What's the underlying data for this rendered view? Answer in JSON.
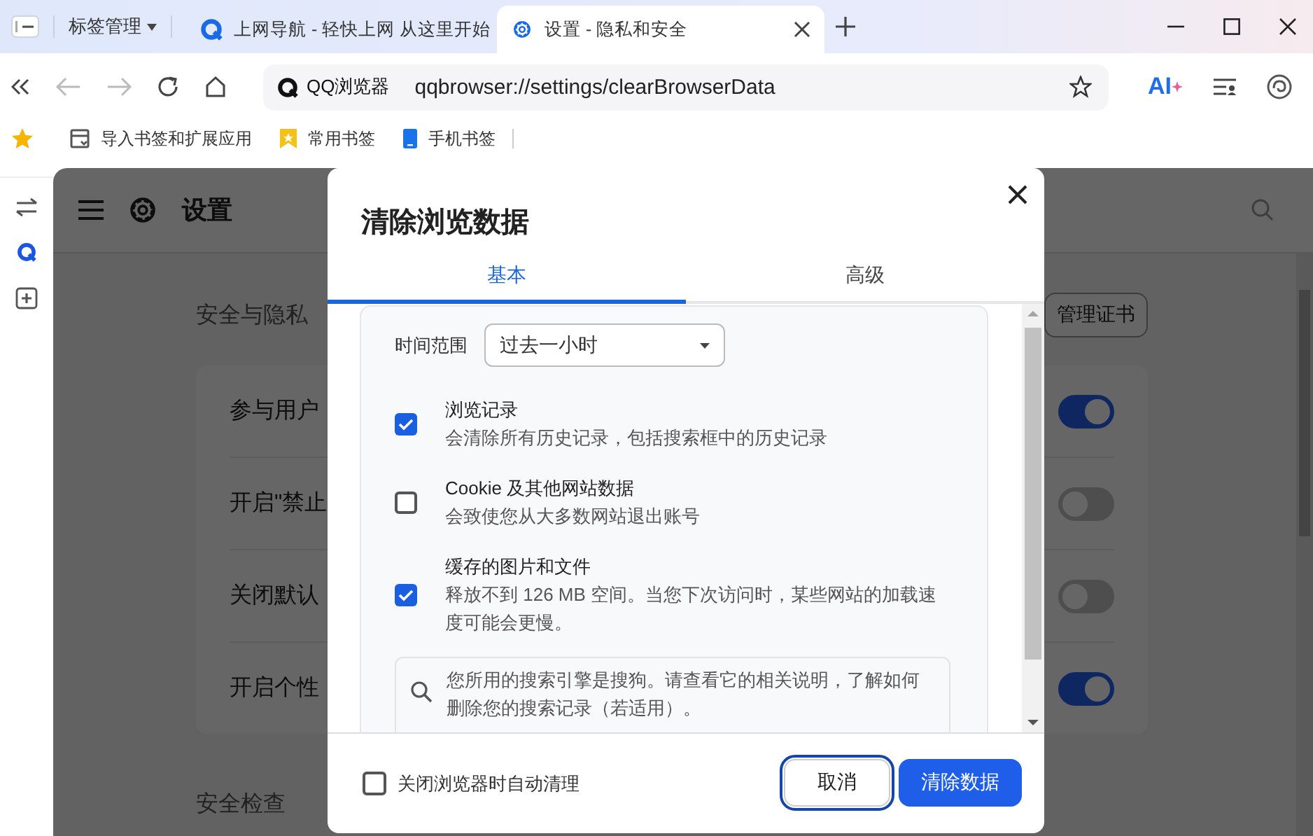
{
  "tab_strip": {
    "tab_manager": "标签管理",
    "tabs": [
      {
        "title": "上网导航 - 轻快上网 从这里开始",
        "kind": "browser",
        "selected": false
      },
      {
        "title": "设置 - 隐私和安全",
        "kind": "settings",
        "selected": true
      }
    ]
  },
  "address_bar": {
    "site_label": "QQ浏览器",
    "url": "qqbrowser://settings/clearBrowserData"
  },
  "toolbar": {
    "ai_label": "AI"
  },
  "bookmarks": [
    {
      "label": "导入书签和扩展应用",
      "kind": "import"
    },
    {
      "label": "常用书签",
      "kind": "folder"
    },
    {
      "label": "手机书签",
      "kind": "phone"
    }
  ],
  "settings": {
    "title": "设置",
    "section_title": "安全与隐私",
    "manage_button": "管理证书",
    "rows": [
      {
        "label": "参与用户",
        "on": true
      },
      {
        "label": "开启\"禁止",
        "on": false
      },
      {
        "label": "关闭默认",
        "on": false
      },
      {
        "label": "开启个性",
        "on": true
      }
    ],
    "next_section": "安全检查"
  },
  "dialog": {
    "title": "清除浏览数据",
    "tabs": [
      {
        "label": "基本",
        "selected": true
      },
      {
        "label": "高级",
        "selected": false
      }
    ],
    "time_range": {
      "label": "时间范围",
      "value": "过去一小时"
    },
    "options": [
      {
        "title": "浏览记录",
        "description": "会清除所有历史记录，包括搜索框中的历史记录",
        "checked": true
      },
      {
        "title": "Cookie 及其他网站数据",
        "description": "会致使您从大多数网站退出账号",
        "checked": false
      },
      {
        "title": "缓存的图片和文件",
        "description": "释放不到 126 MB 空间。当您下次访问时，某些网站的加载速度可能会更慢。",
        "checked": true
      }
    ],
    "notice": "您所用的搜索引擎是搜狗。请查看它的相关说明，了解如何删除您的搜索记录（若适用）。",
    "auto_clear": {
      "label": "关闭浏览器时自动清理",
      "checked": false
    },
    "buttons": [
      {
        "label": "取消",
        "kind": "secondary"
      },
      {
        "label": "清除数据",
        "kind": "primary"
      }
    ]
  }
}
